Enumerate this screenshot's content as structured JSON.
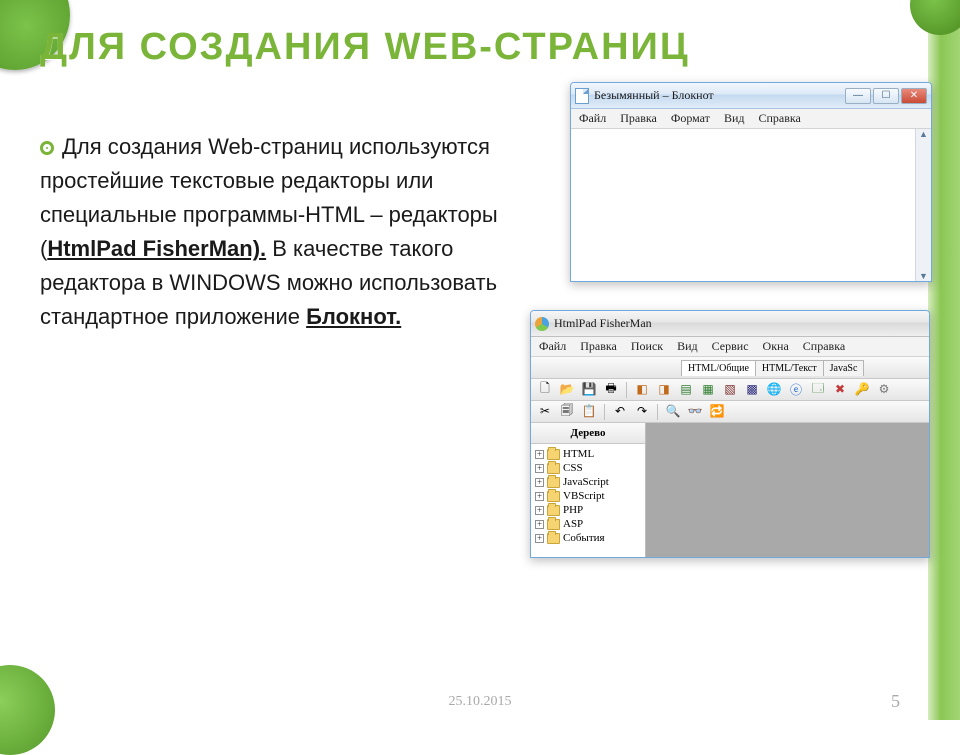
{
  "slide": {
    "title": "ДЛЯ СОЗДАНИЯ WEB-СТРАНИЦ",
    "body_pre": "Для создания Web-страниц используются простейшие текстовые редакторы или специальные программы-HTML – редакторы (",
    "body_link1": "HtmlPad FisherMan).",
    "body_mid": " В качестве такого редактора в WINDOWS можно использовать стандартное приложение ",
    "body_link2": "Блокнот.",
    "footer_date": "25.10.2015",
    "footer_page": "5"
  },
  "notepad": {
    "title": "Безымянный – Блокнот",
    "menu": [
      "Файл",
      "Правка",
      "Формат",
      "Вид",
      "Справка"
    ]
  },
  "htmlpad": {
    "title": "HtmlPad FisherMan",
    "menu": [
      "Файл",
      "Правка",
      "Поиск",
      "Вид",
      "Сервис",
      "Окна",
      "Справка"
    ],
    "tabs": [
      "HTML/Общие",
      "HTML/Текст",
      "JavaSc"
    ],
    "tree_title": "Дерево",
    "tree": [
      "HTML",
      "CSS",
      "JavaScript",
      "VBScript",
      "PHP",
      "ASP",
      "События"
    ]
  }
}
